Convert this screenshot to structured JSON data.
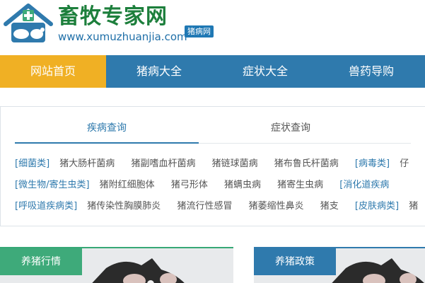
{
  "logo": {
    "title": "畜牧专家网",
    "url": "www.xumuzhuanjia.com",
    "tag": "猪病网"
  },
  "nav": {
    "items": [
      {
        "label": "网站首页",
        "active": true
      },
      {
        "label": "猪病大全",
        "active": false
      },
      {
        "label": "症状大全",
        "active": false
      },
      {
        "label": "兽药导购",
        "active": false
      }
    ]
  },
  "search": {
    "tabs": [
      {
        "label": "疾病查询",
        "active": true
      },
      {
        "label": "症状查询",
        "active": false
      }
    ],
    "rows": [
      [
        "[细菌类]",
        "猪大肠杆菌病",
        "猪副嗜血杆菌病",
        "猪链球菌病",
        "猪布鲁氏杆菌病",
        "[病毒类]",
        "仔"
      ],
      [
        "[微生物/寄生虫类]",
        "猪附红细胞体",
        "猪弓形体",
        "猪螨虫病",
        "猪寄生虫病",
        "[消化道疾病"
      ],
      [
        "[呼吸道疾病类]",
        "猪传染性胸膜肺炎",
        "猪流行性感冒",
        "猪萎缩性鼻炎",
        "猪支",
        "[皮肤病类]",
        "猪"
      ]
    ]
  },
  "cards": [
    {
      "label": "养猪行情"
    },
    {
      "label": "养猪政策"
    }
  ],
  "colors": {
    "brand_green": "#1d7f3c",
    "brand_blue": "#2f7aad",
    "nav_active": "#f0b024",
    "card_green": "#3eaa7a"
  }
}
